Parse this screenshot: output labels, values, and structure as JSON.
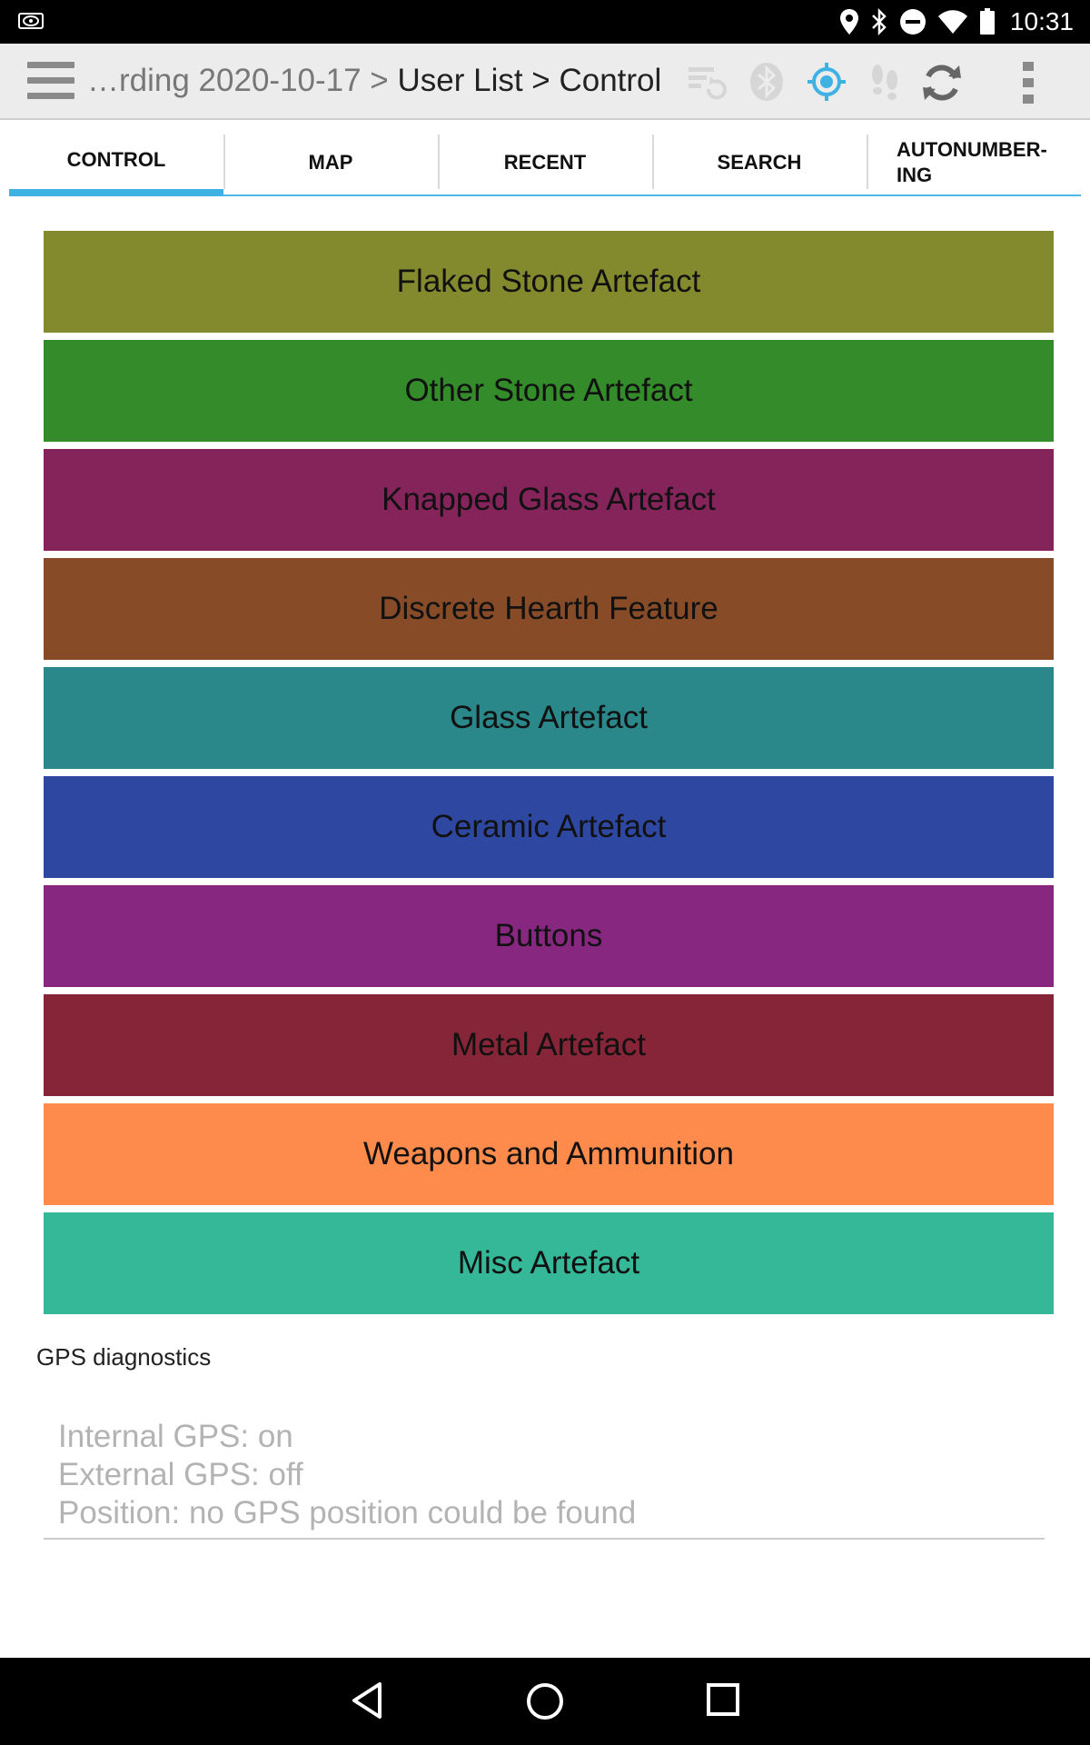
{
  "status_bar": {
    "time": "10:31",
    "icons": [
      "nvidia-icon",
      "location-icon",
      "bluetooth-icon",
      "do-not-disturb-icon",
      "wifi-icon",
      "battery-icon"
    ]
  },
  "action_bar": {
    "breadcrumb_muted": "…rding 2020-10-17 > ",
    "breadcrumb_current": "User List > Control",
    "icons": [
      "menu-icon",
      "sync-status-icon",
      "bluetooth-icon",
      "gps-icon",
      "track-steps-icon",
      "refresh-icon",
      "overflow-menu-icon"
    ]
  },
  "tabs": [
    {
      "label": "CONTROL",
      "active": true
    },
    {
      "label": "MAP",
      "active": false
    },
    {
      "label": "RECENT",
      "active": false
    },
    {
      "label": "SEARCH",
      "active": false
    },
    {
      "label": "AUTONUMBER-ING",
      "active": false
    }
  ],
  "categories": [
    {
      "label": "Flaked Stone Artefact",
      "color": "#838a2d"
    },
    {
      "label": "Other Stone Artefact",
      "color": "#338b2a"
    },
    {
      "label": "Knapped Glass Artefact",
      "color": "#84245b"
    },
    {
      "label": "Discrete Hearth Feature",
      "color": "#874c27"
    },
    {
      "label": "Glass Artefact",
      "color": "#2a878a"
    },
    {
      "label": "Ceramic Artefact",
      "color": "#2e48a2"
    },
    {
      "label": "Buttons",
      "color": "#87277f"
    },
    {
      "label": "Metal Artefact",
      "color": "#852537"
    },
    {
      "label": "Weapons and Ammunition",
      "color": "#fe8b4b"
    },
    {
      "label": "Misc Artefact",
      "color": "#34b898"
    }
  ],
  "gps": {
    "label": "GPS diagnostics",
    "internal": "Internal GPS: on",
    "external": "External GPS: off",
    "position": "Position: no GPS position could be found"
  },
  "colors": {
    "accent": "#3fb2e4",
    "status_bar": "#000000",
    "action_bar": "#ececec"
  }
}
